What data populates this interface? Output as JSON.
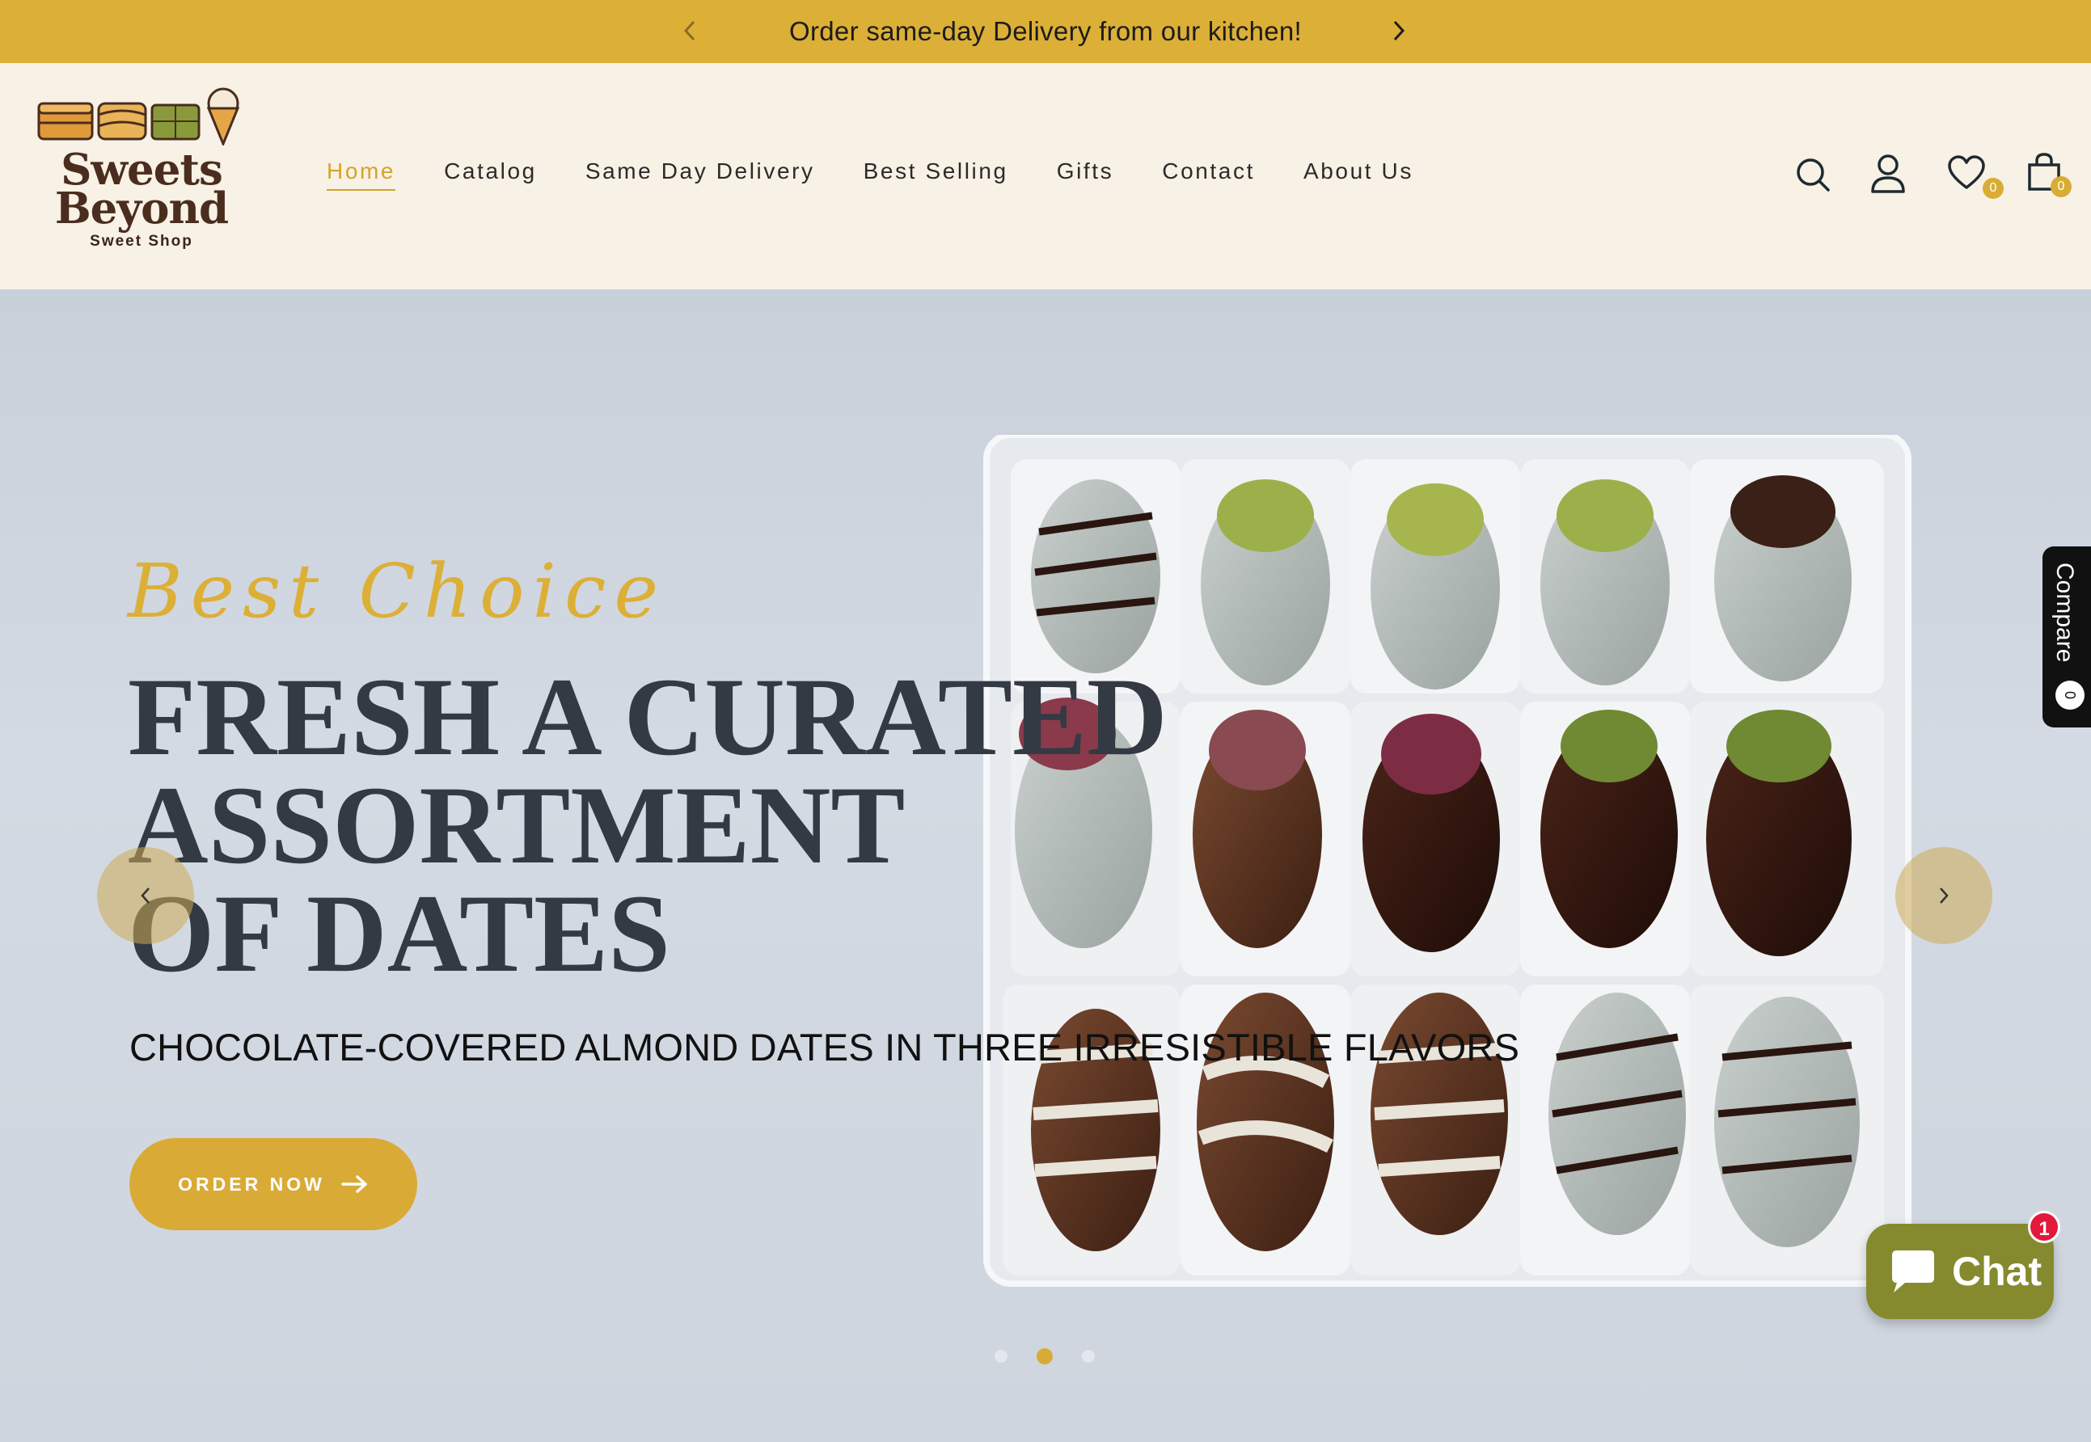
{
  "announcement": {
    "text": "Order same-day Delivery from our kitchen!"
  },
  "logo": {
    "title_line1": "Sweets",
    "title_line2": "Beyond",
    "subtitle": "Sweet Shop"
  },
  "nav": {
    "items": [
      {
        "label": "Home",
        "active": true
      },
      {
        "label": "Catalog"
      },
      {
        "label": "Same Day Delivery"
      },
      {
        "label": "Best Selling"
      },
      {
        "label": "Gifts"
      },
      {
        "label": "Contact"
      },
      {
        "label": "About Us"
      }
    ]
  },
  "header_icons": {
    "wishlist_count": "0",
    "cart_count": "0"
  },
  "hero": {
    "script": "Best Choice",
    "title_line1": "FRESH A CURATED",
    "title_line2": "ASSORTMENT",
    "title_line3": "OF DATES",
    "subtitle": "CHOCOLATE-COVERED ALMOND DATES IN THREE IRRESISTIBLE FLAVORS",
    "button": "ORDER NOW",
    "slides": 3,
    "active_slide": 2
  },
  "compare": {
    "label": "Compare",
    "count": "0"
  },
  "chat": {
    "label": "Chat",
    "badge": "1"
  },
  "colors": {
    "accent": "#dcaf36",
    "header_bg": "#f8f1e5",
    "title": "#333a44",
    "chat": "#858a2e"
  }
}
